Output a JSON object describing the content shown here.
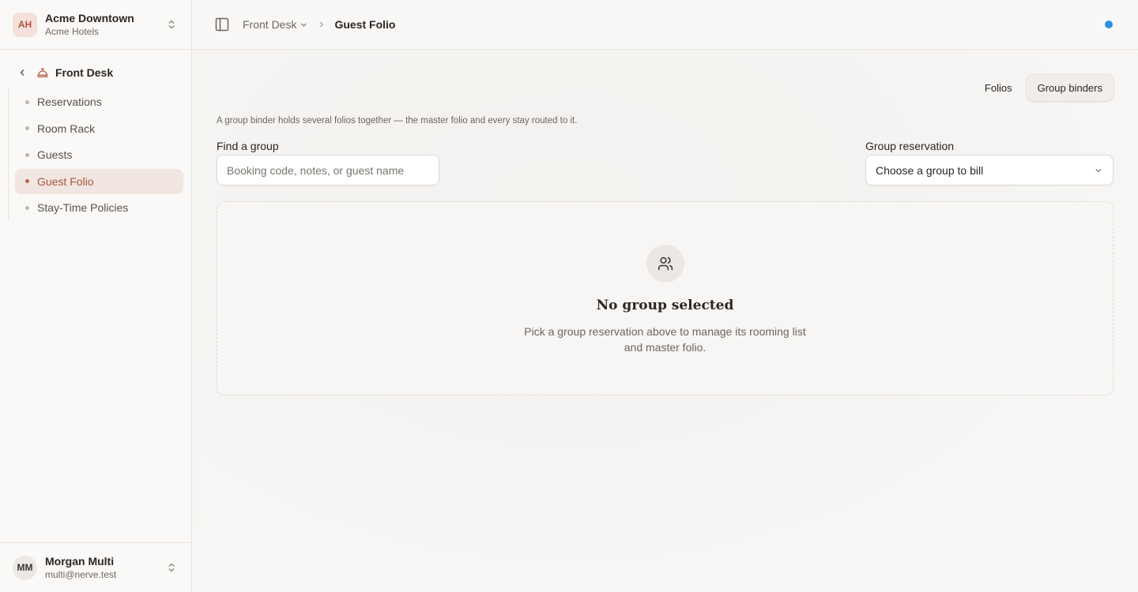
{
  "org": {
    "initials": "AH",
    "name": "Acme Downtown",
    "company": "Acme Hotels"
  },
  "nav": {
    "section": "Front Desk",
    "items": [
      {
        "label": "Reservations",
        "active": false
      },
      {
        "label": "Room Rack",
        "active": false
      },
      {
        "label": "Guests",
        "active": false
      },
      {
        "label": "Guest Folio",
        "active": true
      },
      {
        "label": "Stay-Time Policies",
        "active": false
      }
    ]
  },
  "user": {
    "initials": "MM",
    "name": "Morgan Multi",
    "email": "multi@nerve.test"
  },
  "breadcrumb": {
    "parent": "Front Desk",
    "current": "Guest Folio"
  },
  "status_color": "#2f8fe0",
  "tabs": {
    "folios": "Folios",
    "group_binders": "Group binders",
    "active": "group_binders"
  },
  "hint": "A group binder holds several folios together — the master folio and every stay routed to it.",
  "find": {
    "label": "Find a group",
    "placeholder": "Booking code, notes, or guest name",
    "value": ""
  },
  "group_select": {
    "label": "Group reservation",
    "value": "Choose a group to bill"
  },
  "empty_state": {
    "icon": "users-icon",
    "title": "No group selected",
    "description": "Pick a group reservation above to manage its rooming list and master folio."
  },
  "colors": {
    "accent": "#b0533f",
    "active_nav_bg": "#f1e6e1"
  }
}
